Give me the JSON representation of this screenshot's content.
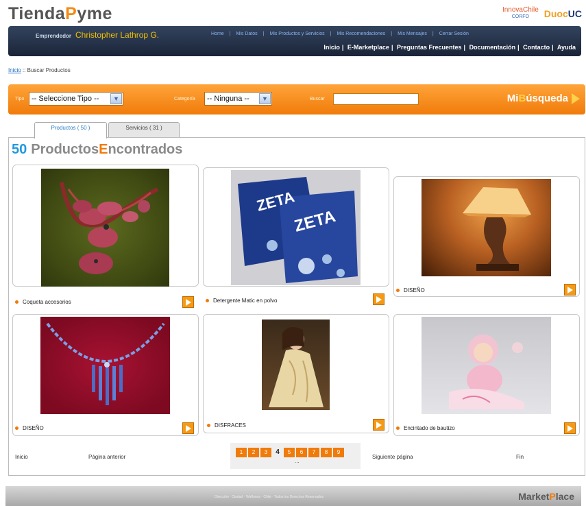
{
  "logo": {
    "part1": "Tienda",
    "part2": "P",
    "part3": "yme"
  },
  "partners": {
    "innova_top": "InnovaChile",
    "innova_bottom": "CORFO",
    "duoc_part1": "Duoc",
    "duoc_part2": "UC"
  },
  "header": {
    "emprendedor_label": "Emprendedor",
    "user_name": "Christopher Lathrop G.",
    "top_links": [
      "Home",
      "Mis Datos",
      "Mis Productos y Servicios",
      "Mis Recomendaciones",
      "Mis Mensajes",
      "Cerrar Sesión"
    ],
    "bottom_links": [
      "Inicio",
      "E-Marketplace",
      "Preguntas Frecuentes",
      "Documentación",
      "Contacto",
      "Ayuda"
    ]
  },
  "breadcrumb": {
    "home": "Inicio",
    "separator": " :: ",
    "current": "Buscar Productos"
  },
  "search": {
    "tipo_label": "Tipo",
    "tipo_value": "-- Seleccione Tipo --",
    "categoria_label": "Categoría",
    "categoria_value": "-- Ninguna --",
    "buscar_label": "Buscar",
    "buscar_value": "",
    "brand_part1": "Mi",
    "brand_part2": "B",
    "brand_part3": "úsqueda"
  },
  "tabs": [
    {
      "label": "Productos ( 50 )",
      "active": true
    },
    {
      "label": "Servicios ( 31 )",
      "active": false
    }
  ],
  "results": {
    "count": "50",
    "title_part1": "Productos",
    "title_part2": "E",
    "title_part3": "ncontrados"
  },
  "products": [
    {
      "label": "Coqueta accesorios",
      "image": "red-flower-necklace"
    },
    {
      "label": "Detergente Matic en polvo",
      "image": "detergent-packages"
    },
    {
      "label": "DISEÑO",
      "image": "table-lamp"
    },
    {
      "label": "DISEÑO",
      "image": "blue-bead-necklace"
    },
    {
      "label": "DISFRACES",
      "image": "costume-dress"
    },
    {
      "label": "Encintado de bautizo",
      "image": "baptism-doll"
    }
  ],
  "pager": {
    "first": "Inicio",
    "prev": "Página anterior",
    "pages_before": [
      "1",
      "2",
      "3"
    ],
    "current": "4",
    "pages_after": [
      "5",
      "6",
      "7",
      "8",
      "9"
    ],
    "more": "...",
    "next": "Siguiente página",
    "last": "Fin"
  },
  "footer": {
    "text": "Dirección · Ciudad · Teléfonos · Chile · Todos los Derechos Reservados",
    "brand_part1": "Market",
    "brand_part2": "P",
    "brand_part3": "lace"
  },
  "colors": {
    "accent_orange": "#f07b0a",
    "nav_dark": "#1a2438",
    "link_blue": "#2a7bc8"
  }
}
